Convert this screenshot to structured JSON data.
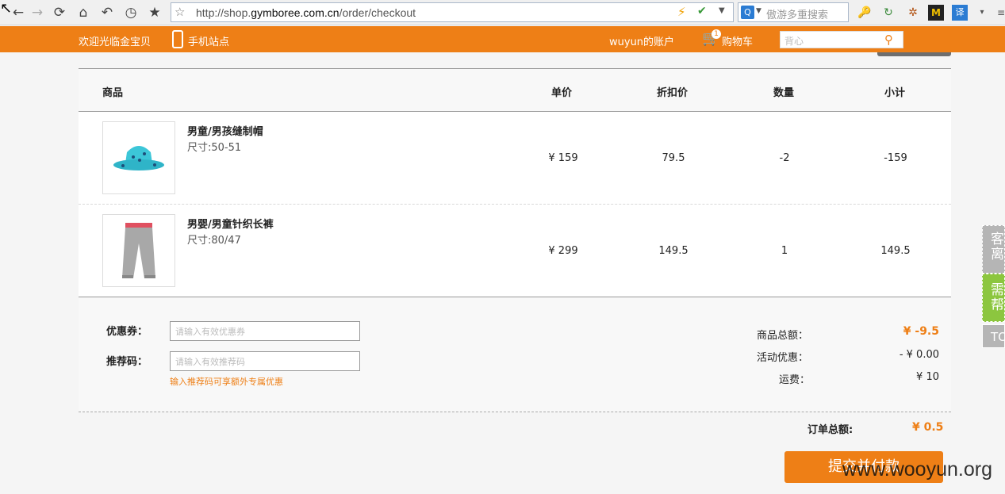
{
  "browser": {
    "url_prefix": "http://shop.",
    "url_host": "gymboree.com.cn",
    "url_path": "/order/checkout",
    "search_placeholder": "傲游多重搜索"
  },
  "header": {
    "welcome": "欢迎光临金宝贝",
    "mobile_site": "手机站点",
    "account": "wuyun的账户",
    "cart_count": "1",
    "cart_label": "购物车",
    "search_placeholder": "背心"
  },
  "table": {
    "columns": [
      "商品",
      "单价",
      "折扣价",
      "数量",
      "小计"
    ],
    "rows": [
      {
        "name": "男童/男孩缝制帽",
        "size": "尺寸:50-51",
        "price": "¥ 159",
        "discount": "79.5",
        "qty": "-2",
        "subtotal": "-159"
      },
      {
        "name": "男婴/男童针织长裤",
        "size": "尺寸:80/47",
        "price": "¥ 299",
        "discount": "149.5",
        "qty": "1",
        "subtotal": "149.5"
      }
    ]
  },
  "form": {
    "coupon_label": "优惠券：",
    "coupon_placeholder": "请输入有效优惠券",
    "referral_label": "推荐码：",
    "referral_placeholder": "请输入有效推荐码",
    "referral_hint": "输入推荐码可享额外专属优惠"
  },
  "summary": {
    "goods_total_label": "商品总额：",
    "goods_total": "¥ -9.5",
    "promo_label": "活动优惠：",
    "promo": "- ¥ 0.00",
    "shipping_label": "运费：",
    "shipping": "¥ 10",
    "order_total_label": "订单总额:",
    "order_total": "¥ 0.5",
    "submit_label": "提交并付款"
  },
  "side_widgets": [
    "客离",
    "需帮",
    "TO"
  ],
  "watermark": "www.wooyun.org",
  "colors": {
    "accent": "#ee7f16",
    "help_green": "#8cc63f"
  }
}
